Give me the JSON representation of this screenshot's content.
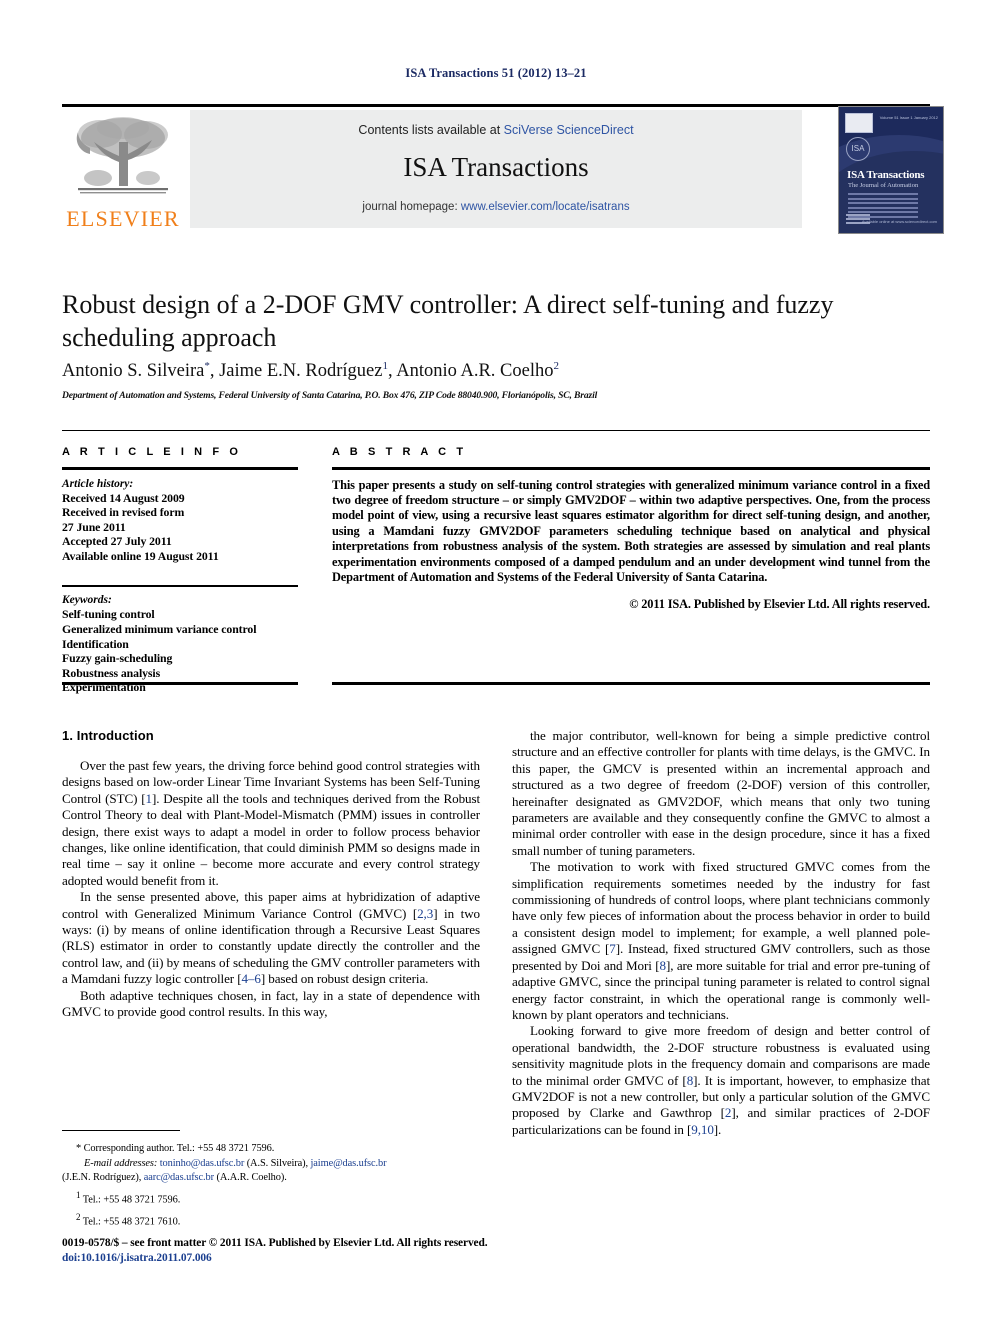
{
  "running_head": "ISA Transactions 51 (2012) 13–21",
  "masthead": {
    "contents_prefix": "Contents lists available at ",
    "contents_link": "SciVerse ScienceDirect",
    "journal_name": "ISA Transactions",
    "homepage_prefix": "journal homepage: ",
    "homepage_url": "www.elsevier.com/locate/isatrans",
    "publisher_logo_word": "ELSEVIER",
    "cover": {
      "title": "ISA Transactions",
      "subtitle": "The Journal of Automation",
      "badge": "ISA",
      "top_text": "Volume 51 Issue 1  January 2012",
      "bottom_right": "Available online at www.sciencedirect.com"
    }
  },
  "article": {
    "title": "Robust design of a 2-DOF GMV controller: A direct self-tuning and fuzzy scheduling approach",
    "authors_html": "Antonio S. Silveira*, Jaime E.N. Rodríguez1, Antonio A.R. Coelho2",
    "affiliation": "Department of Automation and Systems, Federal University of Santa Catarina, P.O. Box 476, ZIP Code 88040.900, Florianópolis, SC, Brazil"
  },
  "info": {
    "heading": "A R T I C L E   I N F O",
    "history_label": "Article history:",
    "history": [
      "Received 14 August 2009",
      "Received in revised form",
      "27 June 2011",
      "Accepted 27 July 2011",
      "Available online 19 August 2011"
    ],
    "keywords_label": "Keywords:",
    "keywords": [
      "Self-tuning control",
      "Generalized minimum variance control",
      "Identification",
      "Fuzzy gain-scheduling",
      "Robustness analysis",
      "Experimentation"
    ]
  },
  "abstract": {
    "heading": "A B S T R A C T",
    "text": "This paper presents a study on self-tuning control strategies with generalized minimum variance control in a fixed two degree of freedom structure – or simply GMV2DOF – within two adaptive perspectives. One, from the process model point of view, using a recursive least squares estimator algorithm for direct self-tuning design, and another, using a Mamdani fuzzy GMV2DOF parameters scheduling technique based on analytical and physical interpretations from robustness analysis of the system. Both strategies are assessed by simulation and real plants experimentation environments composed of a damped pendulum and an under development wind tunnel from the Department of Automation and Systems of the Federal University of Santa Catarina.",
    "copyright": "© 2011 ISA. Published by Elsevier Ltd. All rights reserved."
  },
  "body": {
    "section_heading": "1. Introduction",
    "left_paragraphs": [
      "Over the past few years, the driving force behind good control strategies with designs based on low-order Linear Time Invariant Systems has been Self-Tuning Control (STC) [1]. Despite all the tools and techniques derived from the Robust Control Theory to deal with Plant-Model-Mismatch (PMM) issues in controller design, there exist ways to adapt a model in order to follow process behavior changes, like online identification, that could diminish PMM so designs made in real time – say it online – become more accurate and every control strategy adopted would benefit from it.",
      "In the sense presented above, this paper aims at hybridization of adaptive control with Generalized Minimum Variance Control (GMVC) [2,3] in two ways: (i) by means of online identification through a Recursive Least Squares (RLS) estimator in order to constantly update directly the controller and the control law, and (ii) by means of scheduling the GMV controller parameters with a Mamdani fuzzy logic controller [4–6] based on robust design criteria.",
      "Both adaptive techniques chosen, in fact, lay in a state of dependence with GMVC to provide good control results. In this way,"
    ],
    "right_paragraphs": [
      "the major contributor, well-known for being a simple predictive control structure and an effective controller for plants with time delays, is the GMVC. In this paper, the GMCV is presented within an incremental approach and structured as a two degree of freedom (2-DOF) version of this controller, hereinafter designated as GMV2DOF, which means that only two tuning parameters are available and they consequently confine the GMVC to almost a minimal order controller with ease in the design procedure, since it has a fixed small number of tuning parameters.",
      "The motivation to work with fixed structured GMVC comes from the simplification requirements sometimes needed by the industry for fast commissioning of hundreds of control loops, where plant technicians commonly have only few pieces of information about the process behavior in order to build a consistent design model to implement; for example, a well planned pole-assigned GMVC [7]. Instead, fixed structured GMV controllers, such as those presented by Doi and Mori [8], are more suitable for trial and error pre-tuning of adaptive GMVC, since the principal tuning parameter is related to control signal energy factor constraint, in which the operational range is commonly well-known by plant operators and technicians.",
      "Looking forward to give more freedom of design and better control of operational bandwidth, the 2-DOF structure robustness is evaluated using sensitivity magnitude plots in the frequency domain and comparisons are made to the minimal order GMVC of [8]. It is important, however, to emphasize that GMV2DOF is not a new controller, but only a particular solution of the GMVC proposed by Clarke and Gawthrop [2], and similar practices of 2-DOF particularizations can be found in [9,10]."
    ]
  },
  "footnotes": {
    "corresponding": "* Corresponding author. Tel.: +55 48 3721 7596.",
    "email_label": "E-mail addresses:",
    "email1": "toninho@das.ufsc.br",
    "email1_name": "(A.S. Silveira),",
    "email2": "jaime@das.ufsc.br",
    "email2_name": "(J.E.N. Rodríguez),",
    "email3": "aarc@das.ufsc.br",
    "email3_name": "(A.A.R. Coelho).",
    "tel1": "Tel.: +55 48 3721 7596.",
    "tel1_marker": "1",
    "tel2": "Tel.: +55 48 3721 7610.",
    "tel2_marker": "2"
  },
  "footer": {
    "issn_line": "0019-0578/$ – see front matter © 2011 ISA. Published by Elsevier Ltd. All rights reserved.",
    "doi_line": "doi:10.1016/j.isatra.2011.07.006"
  }
}
